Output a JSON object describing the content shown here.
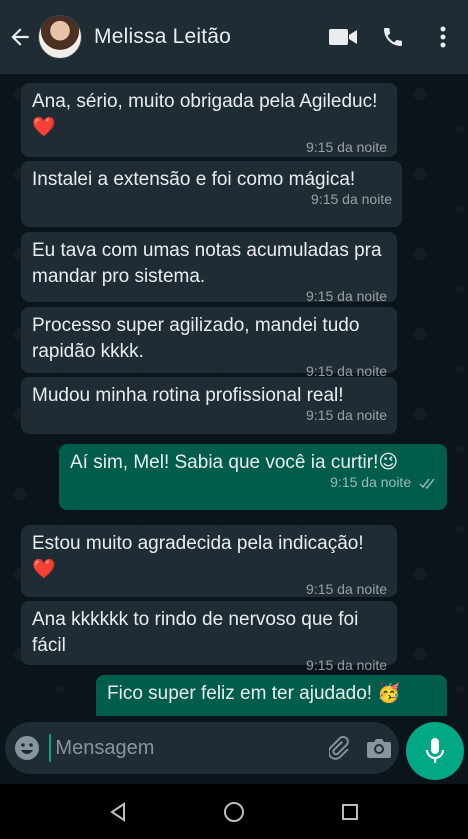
{
  "header": {
    "contact_name": "Melissa Leitão"
  },
  "messages": [
    {
      "direction": "in",
      "text": "Ana, sério, muito obrigada pela Agileduc! ❤️",
      "time": "9:15 da noite"
    },
    {
      "direction": "in",
      "text": "Instalei a extensão e foi como mágica!",
      "time": "9:15 da noite"
    },
    {
      "direction": "in",
      "text": "Eu tava com umas notas acumuladas pra mandar pro sistema.",
      "time": "9:15 da noite"
    },
    {
      "direction": "in",
      "text": "Processo super agilizado, mandei tudo rapidão kkkk.",
      "time": "9:15 da noite"
    },
    {
      "direction": "in",
      "text": "Mudou minha rotina profissional real!",
      "time": "9:15 da noite"
    },
    {
      "direction": "out",
      "text": "Aí sim, Mel! Sabia que você ia curtir!😉",
      "time": "9:15 da noite",
      "status": "read"
    },
    {
      "direction": "in",
      "text": "Estou muito agradecida pela indicação! ❤️",
      "time": "9:15 da noite"
    },
    {
      "direction": "in",
      "text": "Ana kkkkkk to rindo de nervoso que foi fácil",
      "time": "9:15 da noite"
    },
    {
      "direction": "out",
      "text": "Fico super feliz em ter ajudado! 🥳",
      "time": "",
      "status": ""
    }
  ],
  "composer": {
    "placeholder": "Mensagem",
    "value": ""
  },
  "icons": {
    "back": "arrow-left-icon",
    "video": "video-call-icon",
    "call": "phone-icon",
    "menu": "more-vertical-icon",
    "emoji": "emoji-icon",
    "attach": "paperclip-icon",
    "camera": "camera-icon",
    "mic": "microphone-icon"
  },
  "colors": {
    "header_bg": "#1f2c34",
    "incoming_bubble": "#202c33",
    "outgoing_bubble": "#005c4b",
    "accent": "#00a884",
    "background": "#0b141a"
  }
}
